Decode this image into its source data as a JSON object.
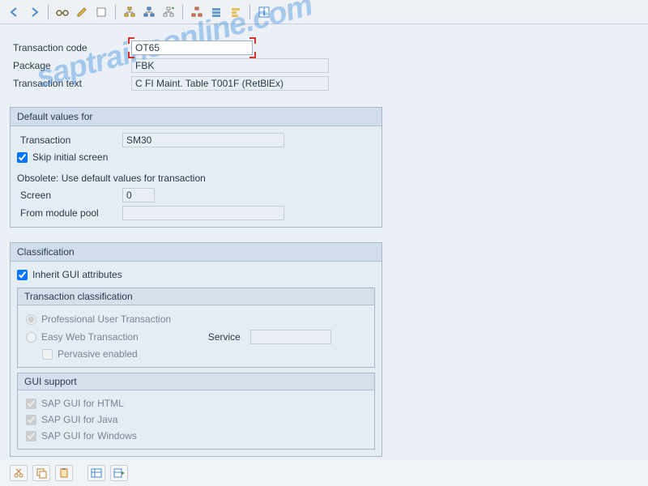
{
  "header": {
    "transaction_code_label": "Transaction code",
    "transaction_code_value": "OT65",
    "package_label": "Package",
    "package_value": "FBK",
    "transaction_text_label": "Transaction text",
    "transaction_text_value": "C FI Maint. Table   T001F (RetBlEx)"
  },
  "default_values": {
    "title": "Default values for",
    "transaction_label": "Transaction",
    "transaction_value": "SM30",
    "skip_initial_label": "Skip initial screen",
    "skip_initial_checked": true,
    "obsolete_text": "Obsolete: Use default values for transaction",
    "screen_label": "Screen",
    "screen_value": "0",
    "module_pool_label": "From module pool",
    "module_pool_value": ""
  },
  "classification": {
    "title": "Classification",
    "inherit_label": "Inherit GUI attributes",
    "inherit_checked": true,
    "trans_class_title": "Transaction classification",
    "radio_prof": "Professional User Transaction",
    "radio_easy": "Easy Web Transaction",
    "service_label": "Service",
    "pervasive_label": "Pervasive enabled",
    "gui_support_title": "GUI support",
    "gui_html": "SAP GUI for HTML",
    "gui_java": "SAP GUI for Java",
    "gui_windows": "SAP GUI for Windows"
  },
  "watermark": "saptrainsonline.com"
}
